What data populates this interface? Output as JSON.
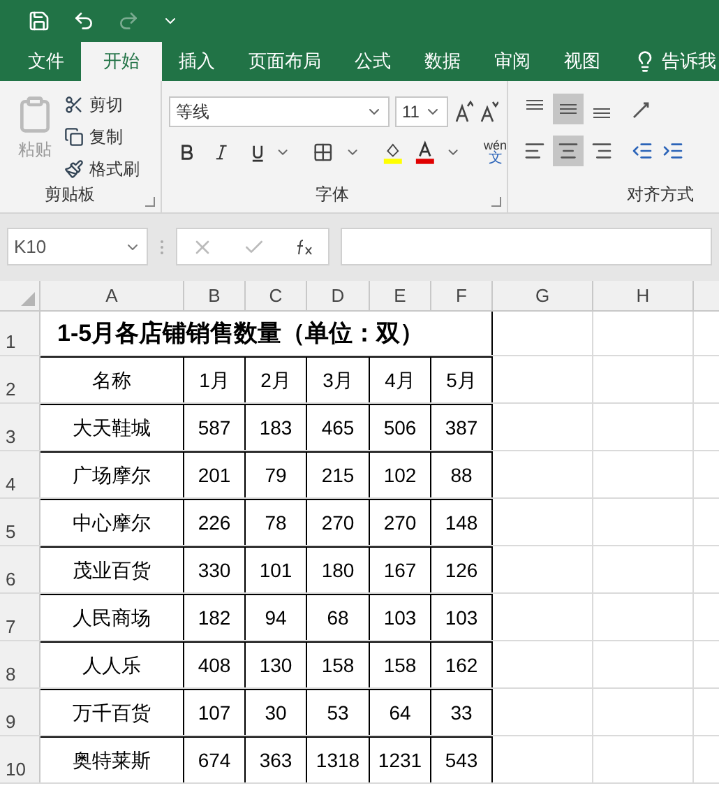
{
  "tabs": [
    {
      "label": "文件",
      "selected": false
    },
    {
      "label": "开始",
      "selected": true
    },
    {
      "label": "插入",
      "selected": false
    },
    {
      "label": "页面布局",
      "selected": false
    },
    {
      "label": "公式",
      "selected": false
    },
    {
      "label": "数据",
      "selected": false
    },
    {
      "label": "审阅",
      "selected": false
    },
    {
      "label": "视图",
      "selected": false
    }
  ],
  "tell_me": "告诉我",
  "clipboard": {
    "paste": "粘贴",
    "items": [
      "剪切",
      "复制",
      "格式刷"
    ],
    "label": "剪贴板"
  },
  "font": {
    "name": "等线",
    "size": "11",
    "phonetic_top": "wén",
    "phonetic_bottom": "文",
    "label": "字体"
  },
  "alignment": {
    "vertical": [
      {
        "selected": false
      },
      {
        "selected": true
      },
      {
        "selected": false
      }
    ],
    "horizontal": [
      {
        "selected": false
      },
      {
        "selected": true
      },
      {
        "selected": false
      }
    ],
    "label": "对齐方式"
  },
  "name_box": "K10",
  "columns": [
    "A",
    "B",
    "C",
    "D",
    "E",
    "F",
    "G",
    "H"
  ],
  "title": "1-5月各店铺销售数量（单位：双）",
  "row_numbers": [
    "1",
    "2",
    "3",
    "4",
    "5",
    "6",
    "7",
    "8",
    "9",
    "10"
  ],
  "rows": [
    [
      "名称",
      "1月",
      "2月",
      "3月",
      "4月",
      "5月"
    ],
    [
      "大天鞋城",
      "587",
      "183",
      "465",
      "506",
      "387"
    ],
    [
      "广场摩尔",
      "201",
      "79",
      "215",
      "102",
      "88"
    ],
    [
      "中心摩尔",
      "226",
      "78",
      "270",
      "270",
      "148"
    ],
    [
      "茂业百货",
      "330",
      "101",
      "180",
      "167",
      "126"
    ],
    [
      "人民商场",
      "182",
      "94",
      "68",
      "103",
      "103"
    ],
    [
      "人人乐",
      "408",
      "130",
      "158",
      "158",
      "162"
    ],
    [
      "万千百货",
      "107",
      "30",
      "53",
      "64",
      "33"
    ],
    [
      "奥特莱斯",
      "674",
      "363",
      "1318",
      "1231",
      "543"
    ]
  ]
}
